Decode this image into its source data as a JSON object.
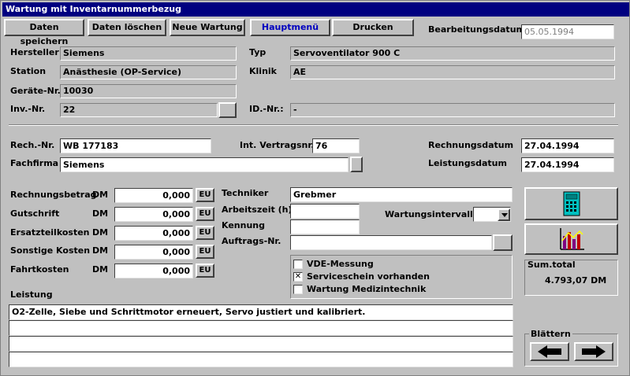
{
  "window": {
    "title": "Wartung mit Inventarnummerbezug"
  },
  "toolbar": {
    "save_label": "Daten speichern",
    "delete_label": "Daten löschen",
    "new_label": "Neue Wartung",
    "main_menu_label": "Hauptmenü",
    "print_label": "Drucken"
  },
  "header": {
    "bearbeitungsdatum_label": "Bearbeitungsdatum",
    "bearbeitungsdatum_value": "05.05.1994"
  },
  "device": {
    "hersteller_label": "Hersteller",
    "hersteller_value": "Siemens",
    "typ_label": "Typ",
    "typ_value": "Servoventilator 900 C",
    "station_label": "Station",
    "station_value": "Anästhesie (OP-Service)",
    "klinik_label": "Klinik",
    "klinik_value": "AE",
    "geraete_label": "Geräte-Nr.",
    "geraete_value": "10030",
    "inv_label": "Inv.-Nr.",
    "inv_value": "22",
    "id_label": "ID.-Nr.:",
    "id_value": "-"
  },
  "invoice": {
    "rech_label": "Rech.-Nr.",
    "rech_value": "WB 177183",
    "vertrag_label": "Int. Vertragsnr.",
    "vertrag_value": "76",
    "rechnungsdatum_label": "Rechnungsdatum",
    "rechnungsdatum_value": "27.04.1994",
    "fachfirma_label": "Fachfirma",
    "fachfirma_value": "Siemens",
    "leistungsdatum_label": "Leistungsdatum",
    "leistungsdatum_value": "27.04.1994"
  },
  "costs": {
    "currency": "DM",
    "eu_label": "EU",
    "rows": [
      {
        "label": "Rechnungsbetrag",
        "value": "0,000"
      },
      {
        "label": "Gutschrift",
        "value": "0,000"
      },
      {
        "label": "Ersatzteilkosten",
        "value": "0,000"
      },
      {
        "label": "Sonstige Kosten",
        "value": "0,000"
      },
      {
        "label": "Fahrtkosten",
        "value": "0,000"
      }
    ]
  },
  "service": {
    "techniker_label": "Techniker",
    "techniker_value": "Grebmer",
    "arbeitszeit_label": "Arbeitszeit (h)",
    "arbeitszeit_value": "",
    "kennung_label": "Kennung",
    "kennung_value": "",
    "auftrags_label": "Auftrags-Nr.",
    "auftrags_value": "",
    "intervall_label": "Wartungsintervall",
    "intervall_value": ""
  },
  "checkboxes": [
    {
      "label": "VDE-Messung",
      "checked": false,
      "mark": ""
    },
    {
      "label": "Serviceschein vorhanden",
      "checked": true,
      "mark": "✕"
    },
    {
      "label": "Wartung Medizintechnik",
      "checked": false,
      "mark": ""
    }
  ],
  "summary": {
    "sum_label": "Sum.total",
    "sum_value": "4.793,07 DM"
  },
  "leistung": {
    "label": "Leistung",
    "lines": [
      "O2-Zelle, Siebe und Schrittmotor erneuert, Servo justiert und kalibriert.",
      "",
      "",
      ""
    ]
  },
  "navigation": {
    "label": "Blättern"
  },
  "icons": {
    "calculator": "calculator-icon",
    "chart": "bar-chart-icon",
    "prev": "arrow-left-icon",
    "next": "arrow-right-icon"
  }
}
